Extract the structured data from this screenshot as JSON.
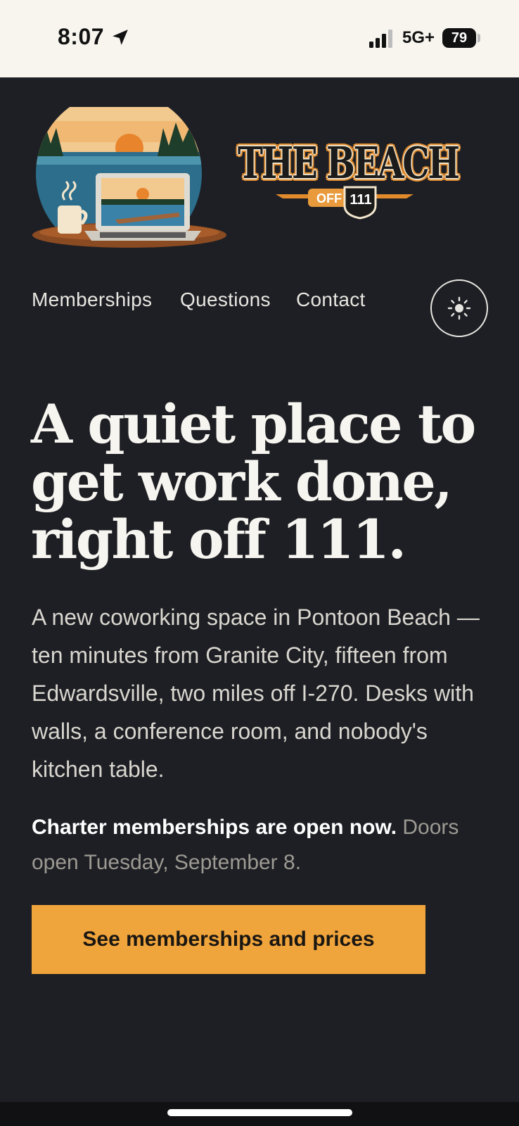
{
  "status_bar": {
    "time": "8:07",
    "network": "5G+",
    "battery": "79",
    "icons": [
      "location-arrow-icon",
      "signal-bars-icon",
      "battery-icon"
    ]
  },
  "logo": {
    "wordmark": "THE BEACH",
    "off_label": "OFF",
    "route_number": "111",
    "colors": {
      "accent": "#e08a2c",
      "ink": "#1b1b1b",
      "cream": "#f3e6cc"
    }
  },
  "nav": {
    "items": [
      {
        "label": "Memberships"
      },
      {
        "label": "Questions"
      },
      {
        "label": "Contact"
      }
    ],
    "theme_toggle_icon": "sun-icon"
  },
  "hero": {
    "title_lines": [
      "A quiet place to",
      "get work done,",
      "right off 111."
    ],
    "description": "A new coworking space in Pontoon Beach — ten minutes from Granite City, fifteen from Edwardsville, two miles off I-270. Desks with walls, a conference room, and nobody's kitchen table.",
    "charter_bold": "Charter memberships are open now.",
    "charter_rest": " Doors open Tuesday, September 8.",
    "cta_label": "See memberships and prices"
  },
  "colors": {
    "background": "#1e1f24",
    "cta": "#f0a43c",
    "status_bar_bg": "#f8f5ef",
    "muted_text": "#9d9a93"
  }
}
